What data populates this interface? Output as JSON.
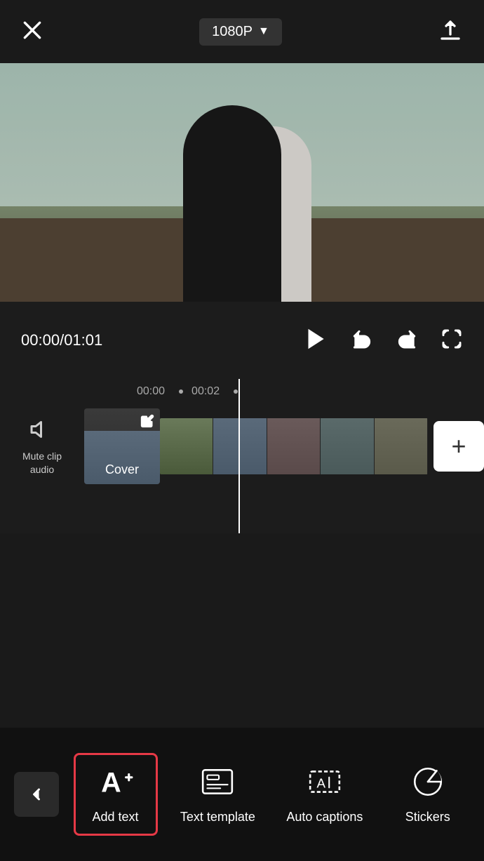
{
  "header": {
    "quality": "1080P",
    "quality_arrow": "▼"
  },
  "controls": {
    "time_current": "00:00",
    "time_total": "01:01",
    "time_separator": "/"
  },
  "timeline": {
    "ruler": {
      "mark1": "00:00",
      "mark2": "00:02"
    },
    "cover_label": "Cover",
    "mute_label": "Mute clip\naudio"
  },
  "toolbar": {
    "add_text_label": "Add text",
    "text_template_label": "Text template",
    "auto_captions_label": "Auto captions",
    "stickers_label": "Stickers"
  }
}
